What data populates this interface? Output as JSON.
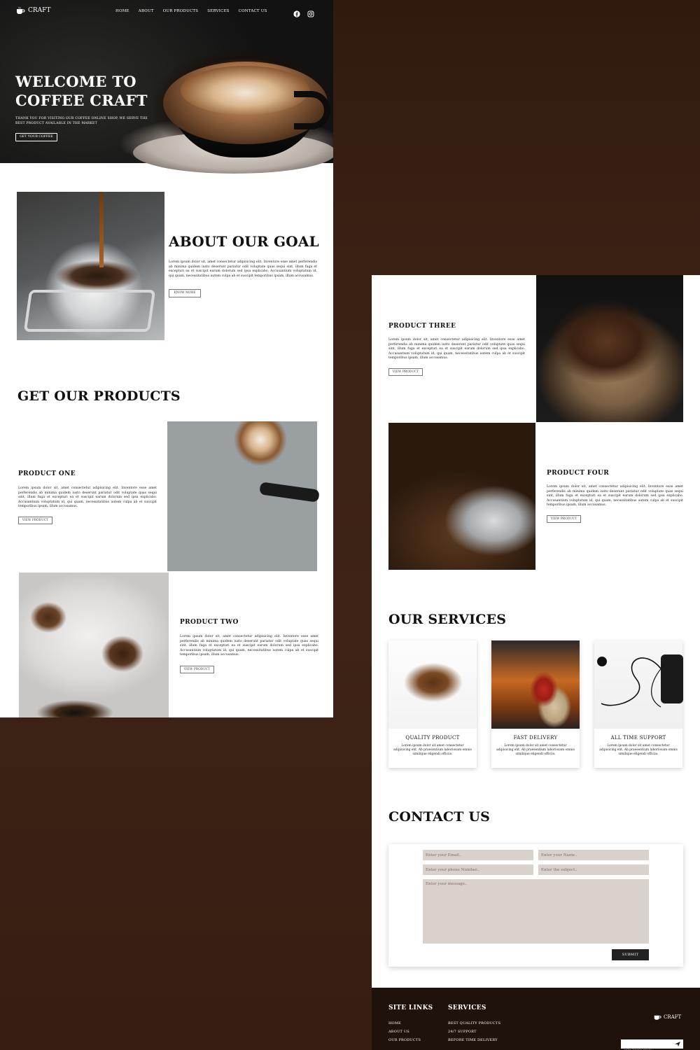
{
  "brand": {
    "name": "CRAFT"
  },
  "nav": {
    "links": [
      "HOME",
      "ABOUT",
      "OUR PRODUCTS",
      "SERVICES",
      "CONTACT US"
    ],
    "icons": [
      "facebook-icon",
      "instagram-icon"
    ]
  },
  "hero": {
    "title": "WELCOME TO COFFEE CRAFT",
    "subtitle": "THANK YOU FOR VISITING OUR COFFEE ONLINE SHOP, WE SERVE THE BEST PRODUCT AVAILABLE IN THE MARKET",
    "button": "GET YOUR COFFEE"
  },
  "about": {
    "title": "ABOUT OUR GOAL",
    "text": "Lorem ipsum dolor sit, amet consectetur adipisicing elit. Inventore esse amet perferendis ab minima quidem iusto deserunt pariatur odit voluptate quas sequi sint, illum fuga et excepturi ea et suscipit earum dolorum sed ipsa explicabo. Accusantium voluptatum id, qui quam, necessitatibus autem culpa ab et suscipit temporibus ipsam, illum accusamus.",
    "button": "KNOW MORE"
  },
  "products": {
    "title": "GET OUR PRODUCTS",
    "items": [
      {
        "name": "PRODUCT ONE",
        "text": "Lorem ipsum dolor sit, amet consectetur adipisicing elit. Inventore esse amet perferendis ab minima quidem iusto deserunt pariatur odit voluptate quas sequi sint, illum fuga et excepturi ea et suscipit earum dolorum sed ipsa explicabo. Accusantium voluptatum id, qui quam, necessitatibus autem culpa ab et suscipit temporibus ipsam, illum accusamus.",
        "button": "VIEW PRODUCT"
      },
      {
        "name": "PRODUCT TWO",
        "text": "Lorem ipsum dolor sit, amet consectetur adipisicing elit. Inventore esse amet perferendis ab minima quidem iusto deserunt pariatur odit voluptate quas sequi sint, illum fuga et excepturi ea et suscipit earum dolorum sed ipsa explicabo. Accusantium voluptatum id, qui quam, necessitatibus autem culpa ab et suscipit temporibus ipsam, illum accusamus.",
        "button": "VIEW PRODUCT"
      },
      {
        "name": "PRODUCT THREE",
        "text": "Lorem ipsum dolor sit, amet consectetur adipisicing elit. Inventore esse amet perferendis ab minima quidem iusto deserunt pariatur odit voluptate quas sequi sint, illum fuga et excepturi ea et suscipit earum dolorum sed ipsa explicabo. Accusantium voluptatum id, qui quam, necessitatibus autem culpa ab et suscipit temporibus ipsam, illum accusamus.",
        "button": "VIEW PRODUCT"
      },
      {
        "name": "PRODUCT FOUR",
        "text": "Lorem ipsum dolor sit, amet consectetur adipisicing elit. Inventore esse amet perferendis ab minima quidem iusto deserunt pariatur odit voluptate quas sequi sint, illum fuga et excepturi ea et suscipit earum dolorum sed ipsa explicabo. Accusantium voluptatum id, qui quam, necessitatibus autem culpa ab et suscipit temporibus ipsam, illum accusamus.",
        "button": "VIEW PRODUCT"
      }
    ]
  },
  "services": {
    "title": "OUR SERVICES",
    "items": [
      {
        "name": "QUALITY PRODUCT",
        "text": "Lorem ipsum dolor sit amet consectetur adipisicing elit. Ab praesentium laboriosam omnis similique eligendi officiis."
      },
      {
        "name": "FAST DELIVERY",
        "text": "Lorem ipsum dolor sit amet consectetur adipisicing elit. Ab praesentium laboriosam omnis similique eligendi officiis."
      },
      {
        "name": "ALL TIME SUPPORT",
        "text": "Lorem ipsum dolor sit amet consectetur adipisicing elit. Ab praesentium laboriosam omnis similique eligendi officiis."
      }
    ]
  },
  "contact": {
    "title": "CONTACT US",
    "email_placeholder": "Enter your Email..",
    "name_placeholder": "Enter your Name..",
    "phone_placeholder": "Enter your phone Number..",
    "subject_placeholder": "Enter the subject..",
    "message_placeholder": "Enter your message..",
    "submit": "SUBMIT"
  },
  "footer": {
    "site_links_title": "SITE LINKS",
    "site_links": [
      "HOME",
      "ABOUT US",
      "OUR PRODUCTS"
    ],
    "services_title": "SERVICES",
    "services": [
      "BEST QUALITY PRODUCTS",
      "24/7 SUPPORT",
      "BEFORE TIME DELIVERY"
    ],
    "newsletter_placeholder": "Your email here..."
  },
  "colors": {
    "footer_bg": "#1f120b",
    "field_bg": "#d9d1cc",
    "submit_bg": "#222222"
  }
}
